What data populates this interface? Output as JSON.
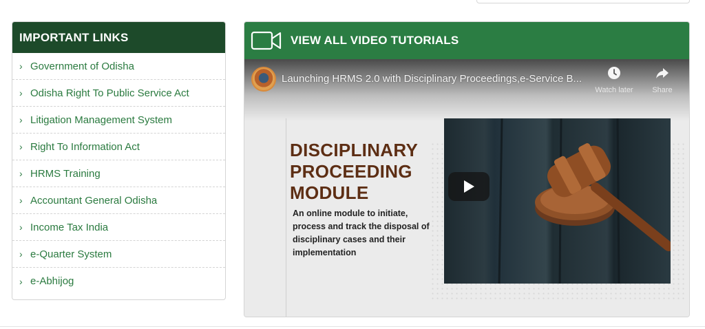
{
  "important_links": {
    "title": "IMPORTANT LINKS",
    "items": [
      {
        "label": "Government of Odisha"
      },
      {
        "label": "Odisha Right To Public Service Act"
      },
      {
        "label": "Litigation Management System"
      },
      {
        "label": "Right To Information Act"
      },
      {
        "label": "HRMS Training"
      },
      {
        "label": "Accountant General Odisha"
      },
      {
        "label": "Income Tax India"
      },
      {
        "label": "e-Quarter System"
      },
      {
        "label": "e-Abhijog"
      }
    ]
  },
  "videos": {
    "title": "VIEW ALL VIDEO TUTORIALS",
    "header_icon": "video-camera-icon",
    "player": {
      "video_title": "Launching HRMS 2.0 with Disciplinary Proceedings,e-Service B...",
      "watch_later_label": "Watch later",
      "share_label": "Share",
      "slide_heading": [
        "DISCIPLINARY",
        "PROCEEDING",
        "MODULE"
      ],
      "slide_description": "An online module to initiate, process and track the disposal of disciplinary cases and their implementation",
      "play_icon": "play-icon"
    }
  },
  "colors": {
    "links_header_bg": "#1d4a2a",
    "video_header_bg": "#2b7d43",
    "link_text": "#2a7a3f",
    "slide_heading": "#5d2e14"
  }
}
